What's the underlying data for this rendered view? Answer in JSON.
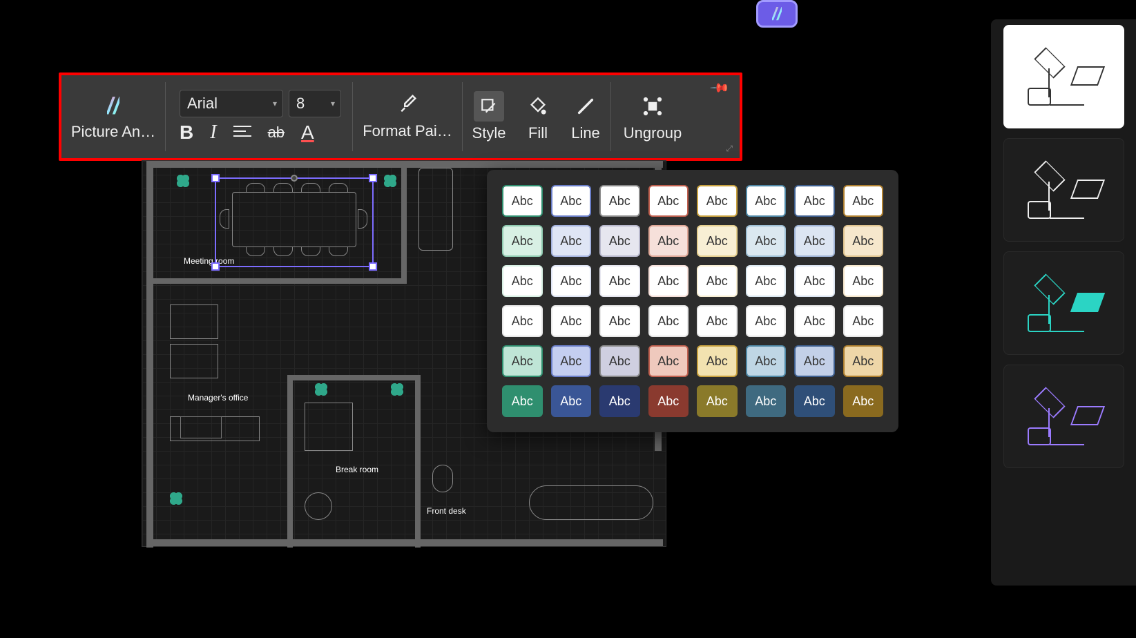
{
  "toolbar": {
    "picture_analysis_label": "Picture An…",
    "font_name": "Arial",
    "font_size": "8",
    "format_painter_label": "Format Pai…",
    "style_label": "Style",
    "fill_label": "Fill",
    "line_label": "Line",
    "ungroup_label": "Ungroup"
  },
  "canvas": {
    "meeting_room_label": "Meeting room",
    "managers_office_label": "Manager's office",
    "break_room_label": "Break room",
    "front_desk_label": "Front desk"
  },
  "style_swatches": {
    "label": "Abc",
    "rows": [
      [
        {
          "bg": "#ffffff",
          "fg": "#333333",
          "bd": "#2f8f6f"
        },
        {
          "bg": "#ffffff",
          "fg": "#333333",
          "bd": "#6a7ec9"
        },
        {
          "bg": "#ffffff",
          "fg": "#333333",
          "bd": "#8a8a8a"
        },
        {
          "bg": "#ffffff",
          "fg": "#333333",
          "bd": "#c0604f"
        },
        {
          "bg": "#ffffff",
          "fg": "#333333",
          "bd": "#c9a23f"
        },
        {
          "bg": "#ffffff",
          "fg": "#333333",
          "bd": "#4f88a6"
        },
        {
          "bg": "#ffffff",
          "fg": "#333333",
          "bd": "#3e5f8f"
        },
        {
          "bg": "#ffffff",
          "fg": "#333333",
          "bd": "#b0802f"
        }
      ],
      [
        {
          "bg": "#d8f0e4",
          "fg": "#333",
          "bd": "#8fcab0"
        },
        {
          "bg": "#dfe5f5",
          "fg": "#333",
          "bd": "#a6b4e0"
        },
        {
          "bg": "#e6e6ef",
          "fg": "#333",
          "bd": "#b8b8cc"
        },
        {
          "bg": "#f6e0da",
          "fg": "#333",
          "bd": "#e0a898"
        },
        {
          "bg": "#f8efd4",
          "fg": "#333",
          "bd": "#e5cf8f"
        },
        {
          "bg": "#dbe8f0",
          "fg": "#333",
          "bd": "#9fc0d5"
        },
        {
          "bg": "#dce5f2",
          "fg": "#333",
          "bd": "#9fb3d5"
        },
        {
          "bg": "#f6e7cc",
          "fg": "#333",
          "bd": "#e0c48f"
        }
      ],
      [
        {
          "bg": "#ffffff",
          "fg": "#333333",
          "bd": "#d8f0e4"
        },
        {
          "bg": "#ffffff",
          "fg": "#333333",
          "bd": "#dfe5f5"
        },
        {
          "bg": "#ffffff",
          "fg": "#333333",
          "bd": "#e6e6ef"
        },
        {
          "bg": "#ffffff",
          "fg": "#333333",
          "bd": "#f6e0da"
        },
        {
          "bg": "#ffffff",
          "fg": "#333333",
          "bd": "#f8efd4"
        },
        {
          "bg": "#ffffff",
          "fg": "#333333",
          "bd": "#dbe8f0"
        },
        {
          "bg": "#ffffff",
          "fg": "#333333",
          "bd": "#dce5f2"
        },
        {
          "bg": "#ffffff",
          "fg": "#333333",
          "bd": "#f6e7cc"
        }
      ],
      [
        {
          "bg": "#ffffff",
          "fg": "#333333",
          "bd": "#e8e8e8"
        },
        {
          "bg": "#ffffff",
          "fg": "#333333",
          "bd": "#e8e8e8"
        },
        {
          "bg": "#ffffff",
          "fg": "#333333",
          "bd": "#e8e8e8"
        },
        {
          "bg": "#ffffff",
          "fg": "#333333",
          "bd": "#e8e8e8"
        },
        {
          "bg": "#ffffff",
          "fg": "#333333",
          "bd": "#e8e8e8"
        },
        {
          "bg": "#ffffff",
          "fg": "#333333",
          "bd": "#e8e8e8"
        },
        {
          "bg": "#ffffff",
          "fg": "#333333",
          "bd": "#e8e8e8"
        },
        {
          "bg": "#ffffff",
          "fg": "#333333",
          "bd": "#e8e8e8"
        }
      ],
      [
        {
          "bg": "#bfe5d6",
          "fg": "#333",
          "bd": "#2f8f6f"
        },
        {
          "bg": "#c4cef0",
          "fg": "#333",
          "bd": "#6a7ec9"
        },
        {
          "bg": "#cfcfe0",
          "fg": "#333",
          "bd": "#8a8a8a"
        },
        {
          "bg": "#efc9bd",
          "fg": "#333",
          "bd": "#c0604f"
        },
        {
          "bg": "#f2e2b0",
          "fg": "#333",
          "bd": "#c9a23f"
        },
        {
          "bg": "#bfd6e5",
          "fg": "#333",
          "bd": "#4f88a6"
        },
        {
          "bg": "#c3d0e8",
          "fg": "#333",
          "bd": "#3e5f8f"
        },
        {
          "bg": "#eed6a8",
          "fg": "#333",
          "bd": "#b0802f"
        }
      ],
      [
        {
          "bg": "#2f8f6f",
          "fg": "#ffffff",
          "bd": "#2f8f6f"
        },
        {
          "bg": "#3a5696",
          "fg": "#ffffff",
          "bd": "#3a5696"
        },
        {
          "bg": "#2a3a70",
          "fg": "#ffffff",
          "bd": "#2a3a70"
        },
        {
          "bg": "#8a3a2f",
          "fg": "#ffffff",
          "bd": "#8a3a2f"
        },
        {
          "bg": "#8a7a2a",
          "fg": "#ffffff",
          "bd": "#8a7a2a"
        },
        {
          "bg": "#3f6a80",
          "fg": "#ffffff",
          "bd": "#3f6a80"
        },
        {
          "bg": "#2f4f78",
          "fg": "#ffffff",
          "bd": "#2f4f78"
        },
        {
          "bg": "#8a6a1f",
          "fg": "#ffffff",
          "bd": "#8a6a1f"
        }
      ]
    ]
  }
}
